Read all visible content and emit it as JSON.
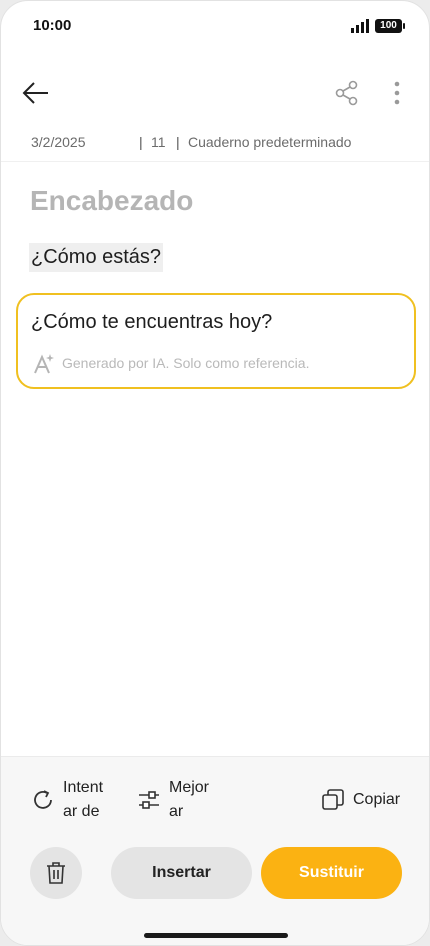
{
  "status_bar": {
    "time": "10:00",
    "battery": "100"
  },
  "toolbar": {
    "back_icon": "arrow-left-icon",
    "share_icon": "share-icon",
    "more_icon": "more-vertical-icon"
  },
  "meta": {
    "date": "3/2/2025",
    "separator": "|",
    "char_count": "11",
    "notebook": "Cuaderno predeterminado"
  },
  "note": {
    "heading": "Encabezado",
    "original_text": "¿Cómo estás?"
  },
  "ai_result": {
    "text": "¿Cómo te encuentras hoy?",
    "disclaimer": "Generado por IA. Solo como referencia.",
    "accent_color": "#f0c020"
  },
  "actions": {
    "retry_label": "Intentar de",
    "improve_label": "Mejorar",
    "copy_label": "Copiar",
    "insert_label": "Insertar",
    "replace_label": "Sustituir",
    "replace_color": "#fbb212"
  }
}
